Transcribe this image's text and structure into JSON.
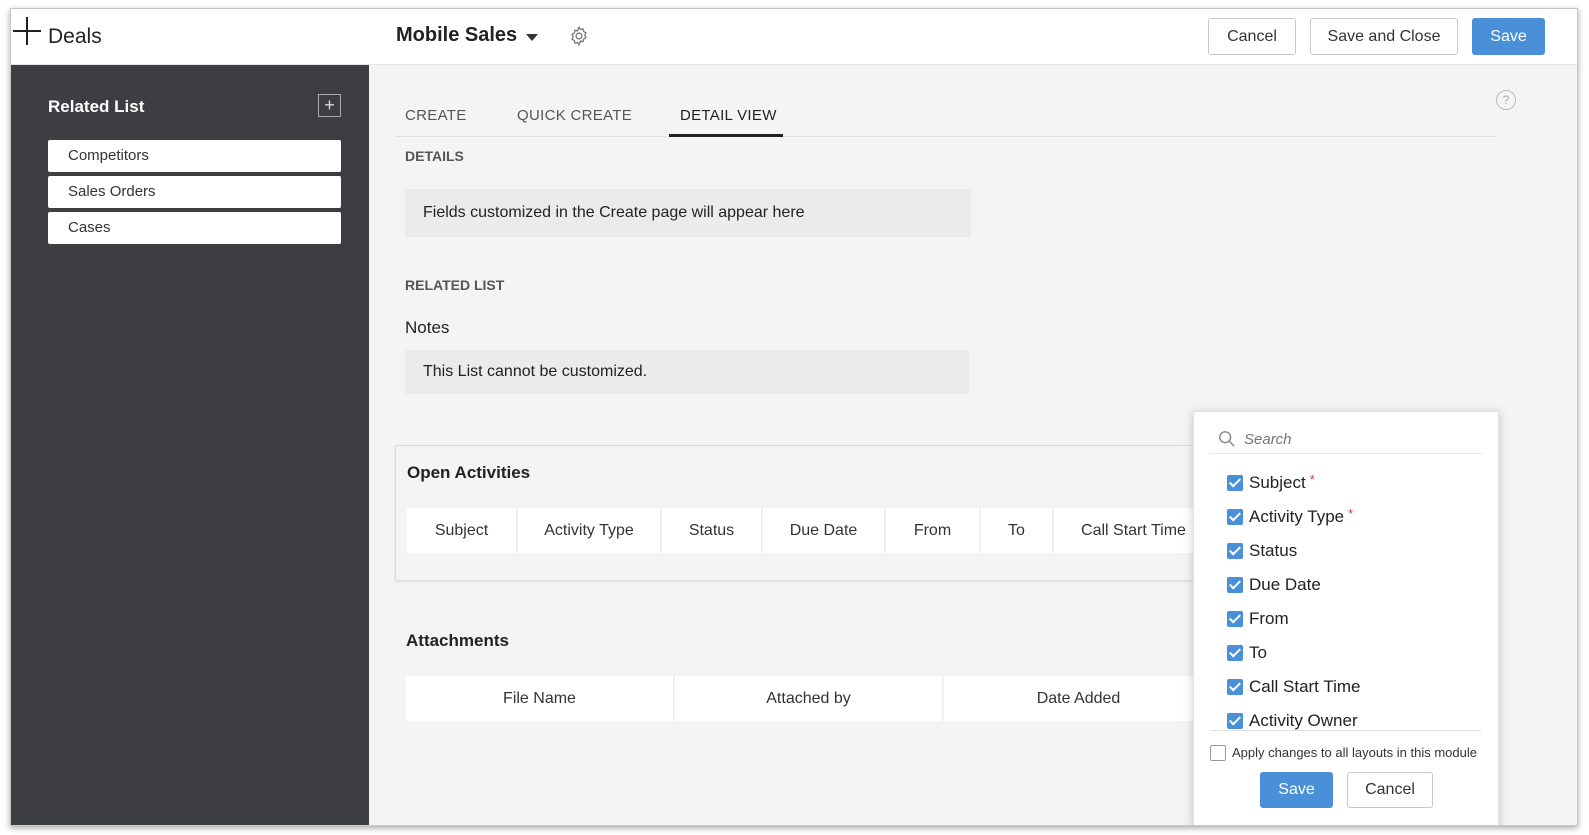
{
  "header": {
    "module_title": "Deals",
    "layout_name": "Mobile Sales",
    "cancel_label": "Cancel",
    "save_close_label": "Save and Close",
    "save_label": "Save"
  },
  "sidebar": {
    "title": "Related List",
    "add_icon": "plus-icon",
    "items": [
      {
        "label": "Competitors"
      },
      {
        "label": "Sales Orders"
      },
      {
        "label": "Cases"
      }
    ]
  },
  "tabs": [
    {
      "label": "CREATE"
    },
    {
      "label": "QUICK CREATE"
    },
    {
      "label": "DETAIL VIEW",
      "active": true
    }
  ],
  "details": {
    "section_label": "DETAILS",
    "info": "Fields customized in the Create page will appear here"
  },
  "related_list": {
    "section_label": "RELATED LIST",
    "notes_label": "Notes",
    "notes_info": "This List cannot be customized."
  },
  "open_activities": {
    "title": "Open Activities",
    "columns": [
      "Subject",
      "Activity Type",
      "Status",
      "Due Date",
      "From",
      "To",
      "Call Start Time"
    ]
  },
  "attachments": {
    "title": "Attachments",
    "columns": [
      "File Name",
      "Attached by",
      "Date Added"
    ]
  },
  "column_picker": {
    "search_placeholder": "Search",
    "options": [
      {
        "label": "Subject",
        "checked": true,
        "required": true
      },
      {
        "label": "Activity Type",
        "checked": true,
        "required": true
      },
      {
        "label": "Status",
        "checked": true,
        "required": false
      },
      {
        "label": "Due Date",
        "checked": true,
        "required": false
      },
      {
        "label": "From",
        "checked": true,
        "required": false
      },
      {
        "label": "To",
        "checked": true,
        "required": false
      },
      {
        "label": "Call Start Time",
        "checked": true,
        "required": false
      },
      {
        "label": "Activity Owner",
        "checked": true,
        "required": false
      }
    ],
    "required_marker": "*",
    "apply_label": "Apply changes to all layouts in this module",
    "apply_checked": false,
    "save_label": "Save",
    "cancel_label": "Cancel"
  },
  "colors": {
    "accent": "#4a90d9",
    "sidebar_bg": "#3c3e42",
    "required": "#e53935"
  }
}
